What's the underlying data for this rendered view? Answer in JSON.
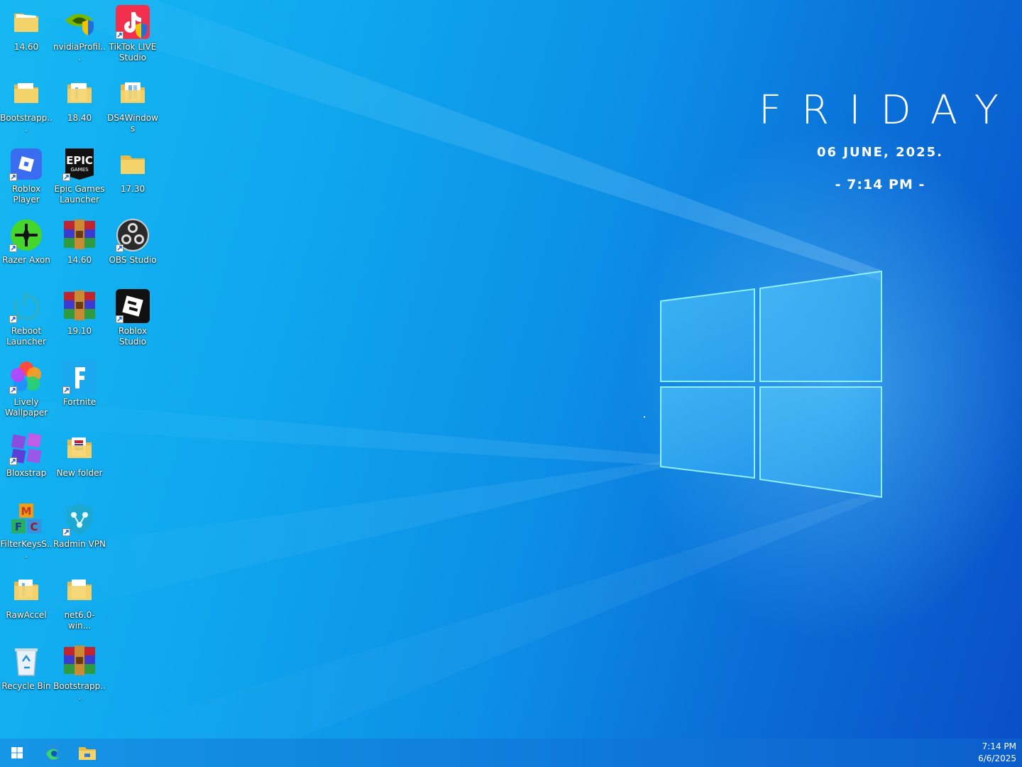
{
  "widget": {
    "day": "FRIDAY",
    "date": "06  JUNE, 2025.",
    "time": "- 7:14 PM -"
  },
  "desktop_icons": [
    {
      "label": "14.60",
      "icon": "folder-icon"
    },
    {
      "label": "nvidiaProfil...",
      "icon": "nvidia-profile-inspector-icon"
    },
    {
      "label": "TikTok LIVE Studio",
      "icon": "tiktok-live-studio-icon"
    },
    {
      "label": "Bootstrapp...",
      "icon": "folder-icon"
    },
    {
      "label": "18.40",
      "icon": "folder-icon"
    },
    {
      "label": "DS4Windows",
      "icon": "folder-icon"
    },
    {
      "label": "Roblox Player",
      "icon": "roblox-player-icon"
    },
    {
      "label": "Epic Games Launcher",
      "icon": "epic-games-icon"
    },
    {
      "label": "17.30",
      "icon": "folder-icon"
    },
    {
      "label": "Razer Axon",
      "icon": "razer-axon-icon"
    },
    {
      "label": "14.60",
      "icon": "winrar-archive-icon"
    },
    {
      "label": "OBS Studio",
      "icon": "obs-studio-icon"
    },
    {
      "label": "Reboot Launcher",
      "icon": "reboot-launcher-icon"
    },
    {
      "label": "19.10",
      "icon": "winrar-archive-icon"
    },
    {
      "label": "Roblox Studio",
      "icon": "roblox-studio-icon"
    },
    {
      "label": "Lively Wallpaper",
      "icon": "lively-wallpaper-icon"
    },
    {
      "label": "Fortnite",
      "icon": "fortnite-icon"
    },
    {
      "label": "Bloxstrap",
      "icon": "bloxstrap-icon"
    },
    {
      "label": "New folder",
      "icon": "folder-icon"
    },
    {
      "label": "FilterKeysS...",
      "icon": "filterkeys-icon"
    },
    {
      "label": "Radmin VPN",
      "icon": "radmin-vpn-icon"
    },
    {
      "label": "RawAccel",
      "icon": "folder-icon"
    },
    {
      "label": "net6.0-win...",
      "icon": "folder-icon"
    },
    {
      "label": "Recycle Bin",
      "icon": "recycle-bin-icon"
    },
    {
      "label": "Bootstrapp...",
      "icon": "winrar-archive-icon"
    }
  ],
  "taskbar": {
    "items": [
      "start-button",
      "edge-icon",
      "file-explorer-icon"
    ],
    "clock_time": "7:14 PM",
    "clock_date": "6/6/2025"
  },
  "colors": {
    "wallpaper_left": "#16b8f3",
    "wallpaper_right": "#0a4fc6",
    "taskbar": "#0f7ddb",
    "label_text": "#ffffff"
  }
}
